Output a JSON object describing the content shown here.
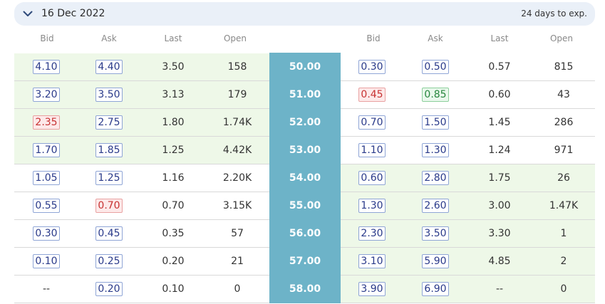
{
  "expiry": {
    "date": "16 Dec 2022",
    "days_label": "24 days to exp.",
    "icon": "chevron-down-icon"
  },
  "columns": {
    "calls": [
      "Bid",
      "Ask",
      "Last",
      "Open"
    ],
    "puts": [
      "Bid",
      "Ask",
      "Last",
      "Open"
    ]
  },
  "colors": {
    "itm": "#eef8e8",
    "strike": "#6db3c8",
    "price_down": "#c73232",
    "price_up": "#27863e"
  },
  "rows": [
    {
      "strike": "50.00",
      "call": {
        "bid": "4.10",
        "bid_state": "",
        "ask": "4.40",
        "ask_state": "",
        "last": "3.50",
        "open": "158",
        "itm": true
      },
      "put": {
        "bid": "0.30",
        "bid_state": "",
        "ask": "0.50",
        "ask_state": "",
        "last": "0.57",
        "open": "815",
        "itm": false
      }
    },
    {
      "strike": "51.00",
      "call": {
        "bid": "3.20",
        "bid_state": "",
        "ask": "3.50",
        "ask_state": "",
        "last": "3.13",
        "open": "179",
        "itm": true
      },
      "put": {
        "bid": "0.45",
        "bid_state": "down",
        "ask": "0.85",
        "ask_state": "up",
        "last": "0.60",
        "open": "43",
        "itm": false
      }
    },
    {
      "strike": "52.00",
      "call": {
        "bid": "2.35",
        "bid_state": "down",
        "ask": "2.75",
        "ask_state": "",
        "last": "1.80",
        "open": "1.74K",
        "itm": true
      },
      "put": {
        "bid": "0.70",
        "bid_state": "",
        "ask": "1.50",
        "ask_state": "",
        "last": "1.45",
        "open": "286",
        "itm": false
      }
    },
    {
      "strike": "53.00",
      "call": {
        "bid": "1.70",
        "bid_state": "",
        "ask": "1.85",
        "ask_state": "",
        "last": "1.25",
        "open": "4.42K",
        "itm": true
      },
      "put": {
        "bid": "1.10",
        "bid_state": "",
        "ask": "1.30",
        "ask_state": "",
        "last": "1.24",
        "open": "971",
        "itm": false
      }
    },
    {
      "strike": "54.00",
      "call": {
        "bid": "1.05",
        "bid_state": "",
        "ask": "1.25",
        "ask_state": "",
        "last": "1.16",
        "open": "2.20K",
        "itm": false
      },
      "put": {
        "bid": "0.60",
        "bid_state": "",
        "ask": "2.80",
        "ask_state": "",
        "last": "1.75",
        "open": "26",
        "itm": true
      }
    },
    {
      "strike": "55.00",
      "call": {
        "bid": "0.55",
        "bid_state": "",
        "ask": "0.70",
        "ask_state": "down",
        "last": "0.70",
        "open": "3.15K",
        "itm": false
      },
      "put": {
        "bid": "1.30",
        "bid_state": "",
        "ask": "2.60",
        "ask_state": "",
        "last": "3.00",
        "open": "1.47K",
        "itm": true
      }
    },
    {
      "strike": "56.00",
      "call": {
        "bid": "0.30",
        "bid_state": "",
        "ask": "0.45",
        "ask_state": "",
        "last": "0.35",
        "open": "57",
        "itm": false
      },
      "put": {
        "bid": "2.30",
        "bid_state": "",
        "ask": "3.50",
        "ask_state": "",
        "last": "3.30",
        "open": "1",
        "itm": true
      }
    },
    {
      "strike": "57.00",
      "call": {
        "bid": "0.10",
        "bid_state": "",
        "ask": "0.25",
        "ask_state": "",
        "last": "0.20",
        "open": "21",
        "itm": false
      },
      "put": {
        "bid": "3.10",
        "bid_state": "",
        "ask": "5.90",
        "ask_state": "",
        "last": "4.85",
        "open": "2",
        "itm": true
      }
    },
    {
      "strike": "58.00",
      "call": {
        "bid": "--",
        "bid_state": "",
        "ask": "0.20",
        "ask_state": "",
        "last": "0.10",
        "open": "0",
        "itm": false
      },
      "put": {
        "bid": "3.90",
        "bid_state": "",
        "ask": "6.90",
        "ask_state": "",
        "last": "--",
        "open": "0",
        "itm": true
      }
    }
  ]
}
